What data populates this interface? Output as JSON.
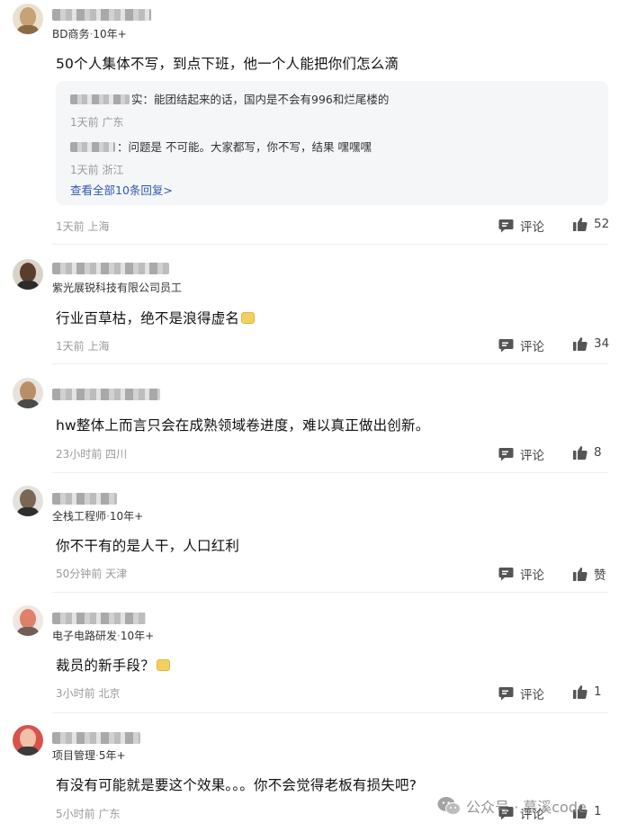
{
  "comments": [
    {
      "role": "BD商务",
      "years": "10年+",
      "text": "50个人集体不写，到点下班，他一个人能把你们怎么滴",
      "replies": [
        {
          "text": "实：能团结起来的话，国内是不会有996和烂尾楼的",
          "meta": "1天前 广东"
        },
        {
          "text": "：问题是 不可能。大家都写，你不写，结果 嘿嘿嘿",
          "meta": "1天前 浙江"
        }
      ],
      "more_replies": "查看全部10条回复>",
      "meta": "1天前 上海",
      "comment_label": "评论",
      "likes": "52"
    },
    {
      "role": "紫光展锐科技有限公司员工",
      "years": "",
      "text": "行业百草枯，绝不是浪得虚名",
      "meta": "1天前 上海",
      "comment_label": "评论",
      "likes": "34"
    },
    {
      "role": "",
      "years": "",
      "text": "hw整体上而言只会在成熟领域卷进度，难以真正做出创新。",
      "meta": "23小时前 四川",
      "comment_label": "评论",
      "likes": "8"
    },
    {
      "role": "全栈工程师",
      "years": "10年+",
      "text": "你不干有的是人干，人口红利",
      "meta": "50分钟前 天津",
      "comment_label": "评论",
      "likes": "赞"
    },
    {
      "role": "电子电路研发",
      "years": "10年+",
      "text": "裁员的新手段？",
      "meta": "3小时前 北京",
      "comment_label": "评论",
      "likes": "1"
    },
    {
      "role": "项目管理",
      "years": "5年+",
      "text": "有没有可能就是要这个效果。。。你不会觉得老板有损失吧?",
      "meta": "5小时前 广东",
      "comment_label": "评论",
      "likes": "1"
    }
  ],
  "watermark": "公众号 · 慕溪code",
  "colors": {
    "link": "#2f58b0",
    "meta": "#9a9a9a",
    "reply_bg": "#f5f6f8"
  },
  "icons": {
    "comment": "comment-icon",
    "like": "thumbs-up-icon",
    "wechat": "wechat-icon"
  }
}
